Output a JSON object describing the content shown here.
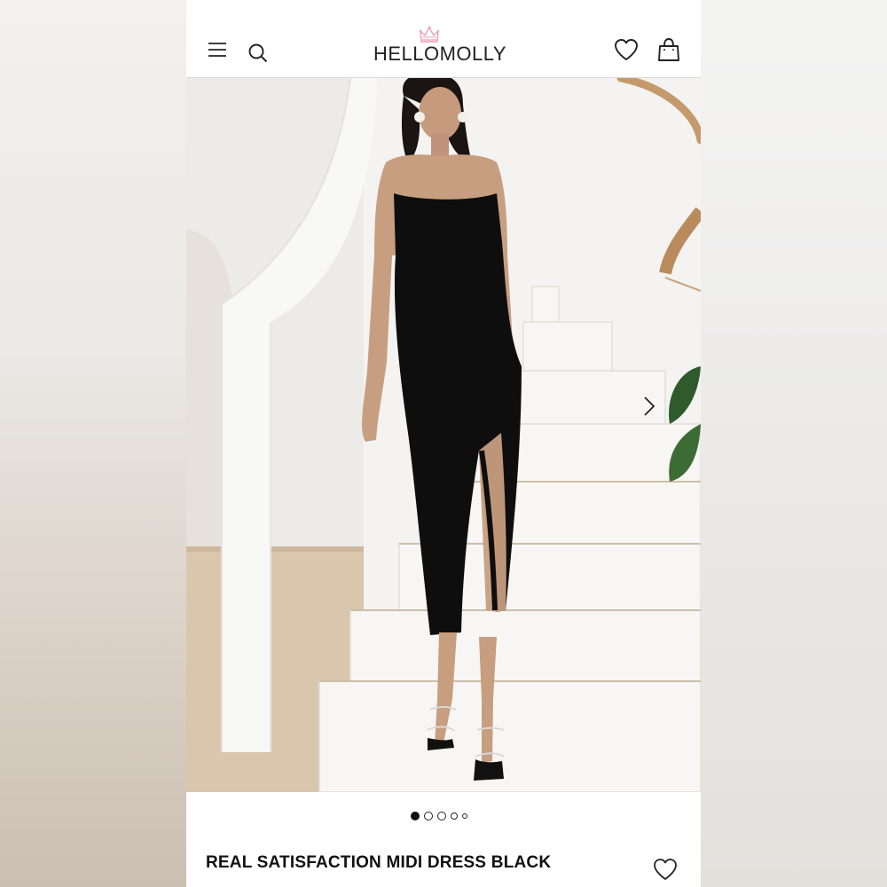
{
  "header": {
    "brand": "HELLOMOLLY"
  },
  "icons": {
    "menu": "hamburger-menu-icon",
    "search": "search-icon",
    "wishlist": "heart-icon",
    "bag": "shopping-bag-icon",
    "next": "chevron-right-icon",
    "logo_crown": "crown-icon"
  },
  "colors": {
    "brand_crown": "#e8a2b8",
    "text": "#111111",
    "dress": "#0d0d0d"
  },
  "carousel": {
    "slide_count": 5,
    "active_index": 0
  },
  "product": {
    "title": "REAL SATISFACTION MIDI DRESS BLACK"
  }
}
